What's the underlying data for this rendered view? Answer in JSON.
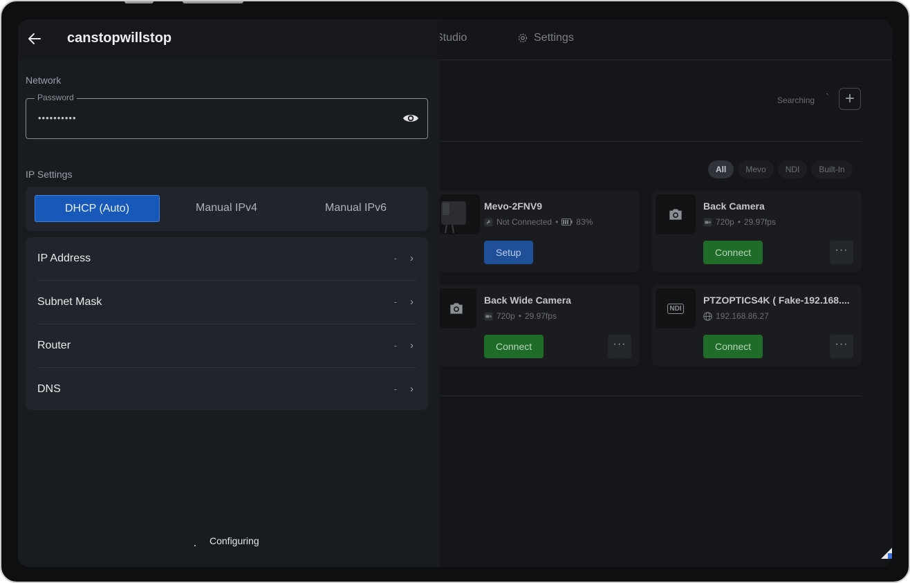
{
  "app": {
    "nav": {
      "studio_label": "Studio",
      "settings_label": "Settings"
    },
    "search_status": "Searching",
    "search_tick": "`",
    "add_symbol": "+",
    "filters": [
      "All",
      "Mevo",
      "NDI",
      "Built-In"
    ],
    "cards": [
      {
        "name": "Mevo-2FNV9",
        "status": "Not Connected",
        "sep": "•",
        "battery": "83%",
        "action": "Setup"
      },
      {
        "name": "Back Camera",
        "resolution": "720p",
        "sep": "•",
        "fps": "29.97fps",
        "action": "Connect",
        "more": "···"
      },
      {
        "name": "Back Wide Camera",
        "resolution": "720p",
        "sep": "•",
        "fps": "29.97fps",
        "action": "Connect",
        "more": "···"
      },
      {
        "name": "PTZOPTICS4K ( Fake-192.168....",
        "ip": "192.168.86.27",
        "badge": "NDI",
        "action": "Connect",
        "more": "···"
      }
    ]
  },
  "panel": {
    "title": "canstopwillstop",
    "network_label": "Network",
    "password_label": "Password",
    "password_value": "••••••••••",
    "ip_settings_label": "IP Settings",
    "modes": [
      "DHCP (Auto)",
      "Manual IPv4",
      "Manual IPv6"
    ],
    "selected_mode": "DHCP (Auto)",
    "fields": [
      {
        "label": "IP Address",
        "value": "-"
      },
      {
        "label": "Subnet Mask",
        "value": "-"
      },
      {
        "label": "Router",
        "value": "-"
      },
      {
        "label": "DNS",
        "value": "-"
      }
    ],
    "footer_status": "Configuring"
  },
  "colors": {
    "accent_blue": "#1758b8",
    "connect_green": "#1f6b28",
    "setup_blue": "#1f4f97"
  }
}
